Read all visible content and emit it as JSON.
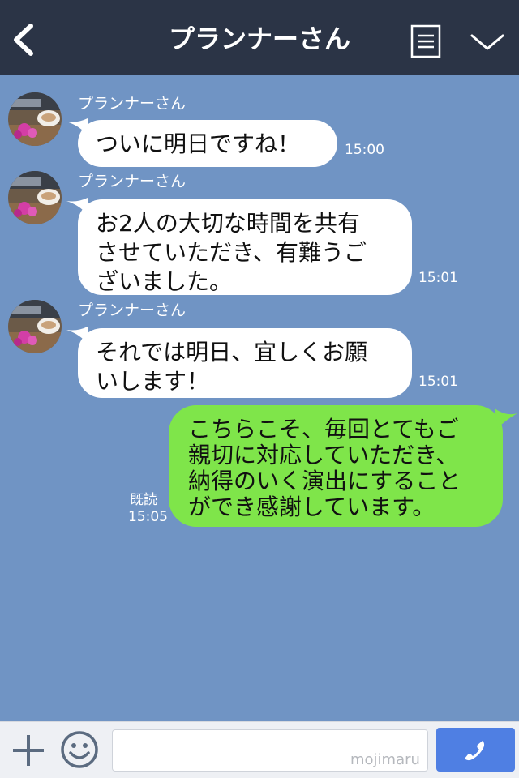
{
  "header": {
    "title": "プランナーさん",
    "back_icon": "chevron-left-icon",
    "menu_icon": "list-menu-icon",
    "expand_icon": "chevron-down-icon",
    "background_color": "#2b3446"
  },
  "chat": {
    "background_color": "#7094c4",
    "messages": [
      {
        "sender": "プランナーさん",
        "line1": "ついに明日ですね！",
        "time": "15:00"
      },
      {
        "sender": "プランナーさん",
        "line1": "お2人の大切な時間を共有",
        "line2": "させていただき、有難うご",
        "line3": "ざいました。",
        "time": "15:01"
      },
      {
        "sender": "プランナーさん",
        "line1": "それでは明日、宜しくお願",
        "line2": "いします！",
        "time": "15:01"
      }
    ],
    "my_message": {
      "line1": "こちらこそ、毎回とてもご",
      "line2": "親切に対応していただき、",
      "line3": "納得のいく演出にすること",
      "line4": "ができ感謝しています。",
      "read_label": "既読",
      "time": "15:05",
      "bubble_color": "#7fe54a"
    }
  },
  "footer": {
    "plus_icon": "plus-icon",
    "emoji_icon": "smiley-icon",
    "input_value": "",
    "watermark": "mojimaru",
    "call_icon": "phone-icon",
    "call_button_color": "#4f7fe3"
  }
}
